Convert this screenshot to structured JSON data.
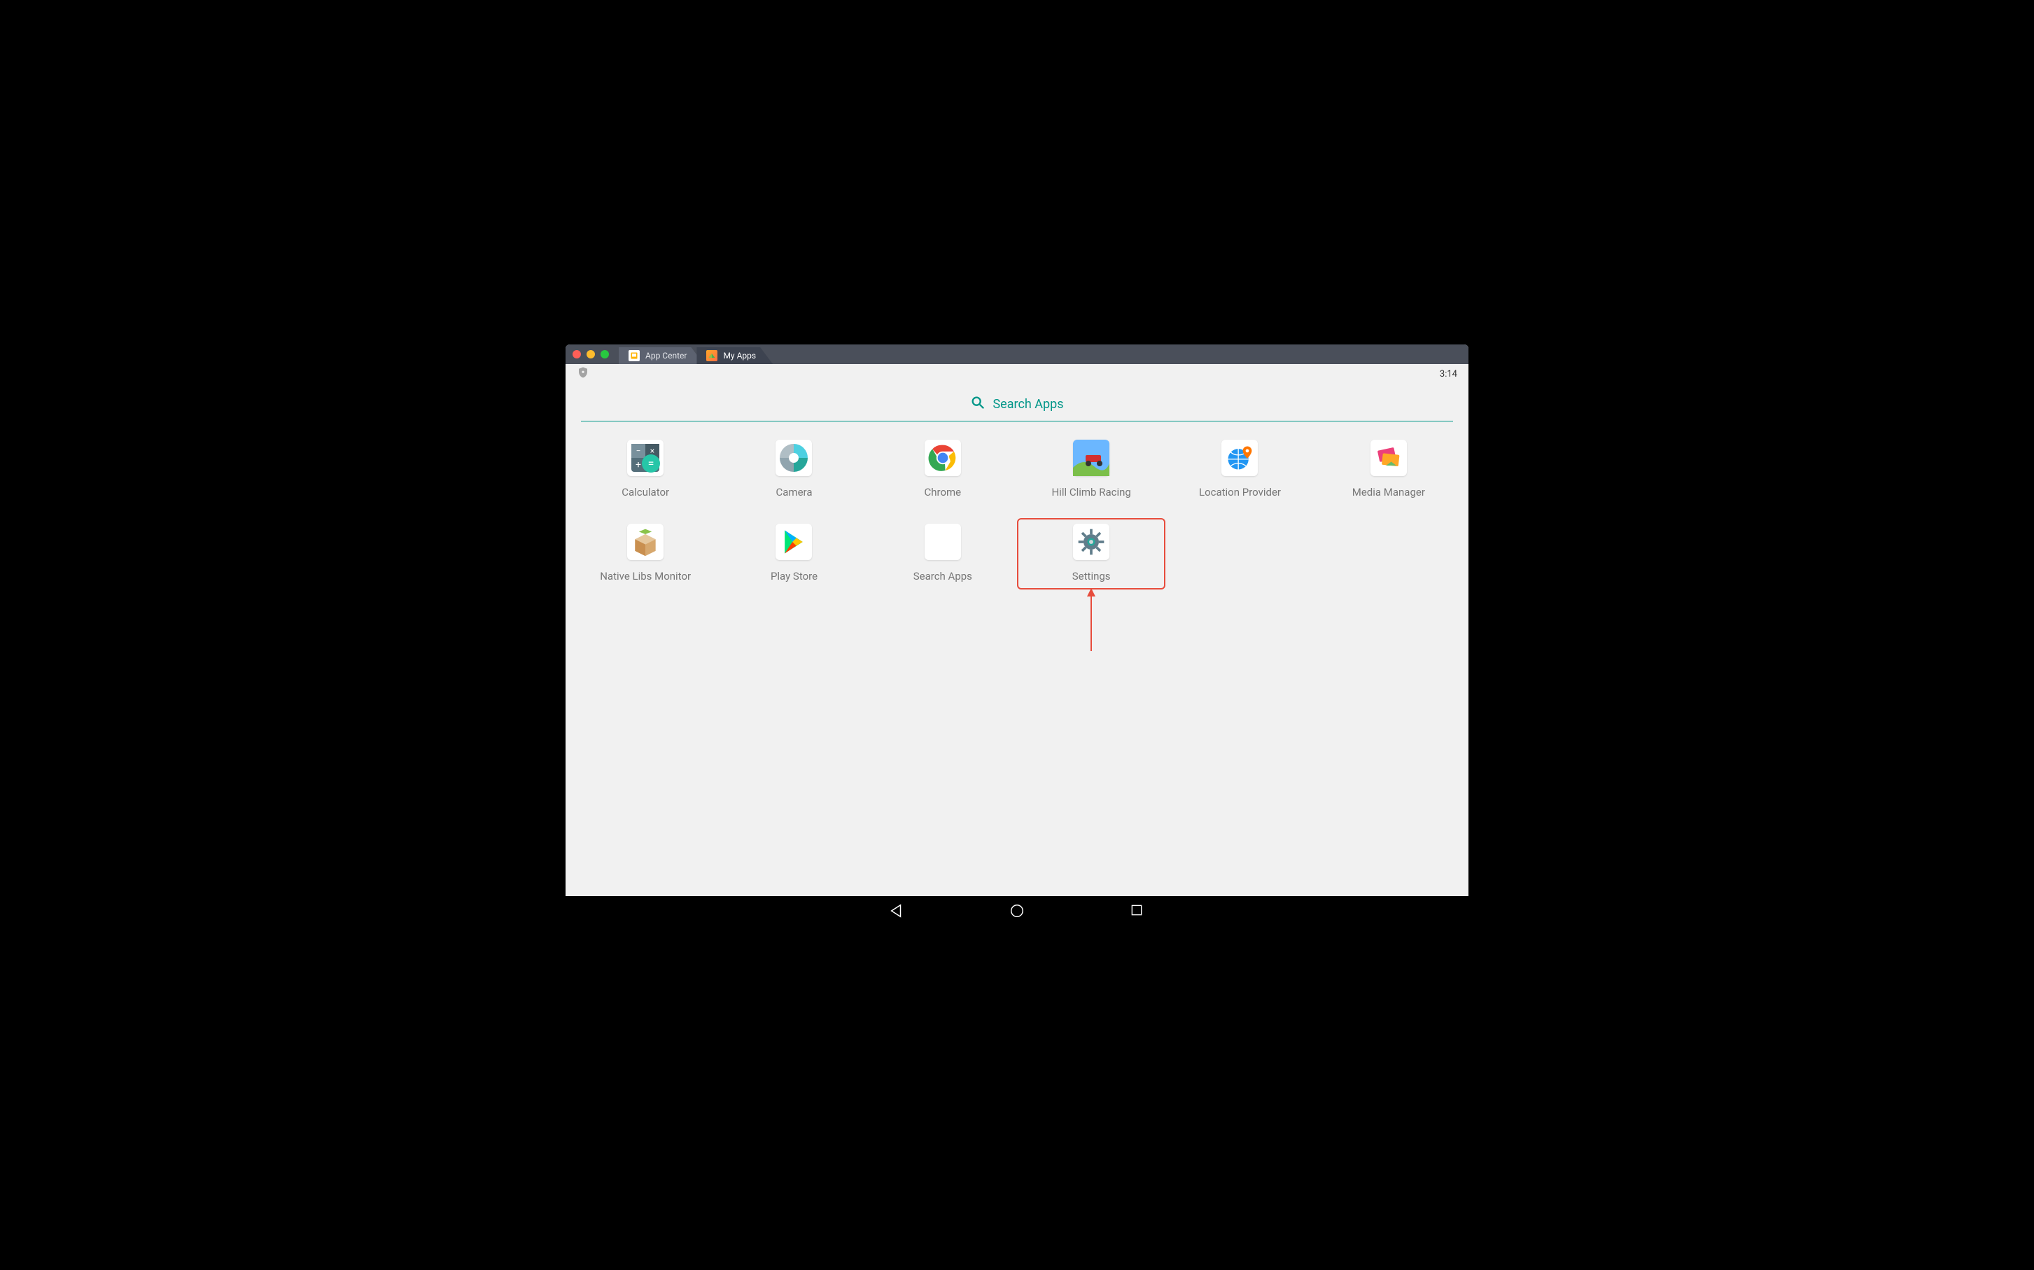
{
  "tabs": [
    {
      "label": "App Center",
      "icon": "app-center-icon",
      "active": false
    },
    {
      "label": "My Apps",
      "icon": "my-apps-icon",
      "active": true
    }
  ],
  "status": {
    "time": "3:14"
  },
  "search": {
    "placeholder": "Search Apps"
  },
  "apps": [
    {
      "label": "Calculator",
      "icon": "calculator-icon"
    },
    {
      "label": "Camera",
      "icon": "camera-icon"
    },
    {
      "label": "Chrome",
      "icon": "chrome-icon"
    },
    {
      "label": "Hill Climb Racing",
      "icon": "hillclimb-icon"
    },
    {
      "label": "Location Provider",
      "icon": "globe-pin-icon"
    },
    {
      "label": "Media Manager",
      "icon": "media-icon"
    },
    {
      "label": "Native Libs Monitor",
      "icon": "box-icon"
    },
    {
      "label": "Play Store",
      "icon": "playstore-icon"
    },
    {
      "label": "Search Apps",
      "icon": "search-tile-icon"
    },
    {
      "label": "Settings",
      "icon": "gear-icon",
      "highlight": true
    }
  ],
  "colors": {
    "accent": "#009688",
    "callout": "#e74c3c"
  }
}
